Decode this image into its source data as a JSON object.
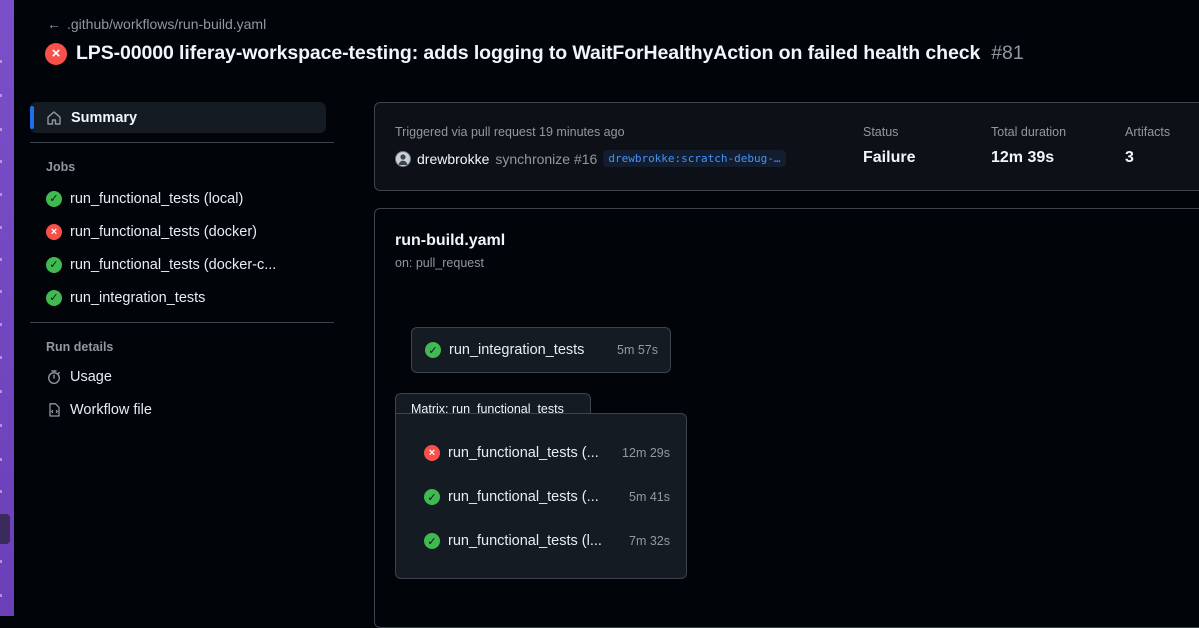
{
  "header": {
    "back_label": ".github/workflows/run-build.yaml",
    "title": "LPS-00000 liferay-workspace-testing: adds logging to WaitForHealthyAction on failed health check",
    "run_number": "#81",
    "status_icon": "x-circle-icon"
  },
  "sidebar": {
    "summary_label": "Summary",
    "jobs_heading": "Jobs",
    "jobs": [
      {
        "label": "run_functional_tests (local)",
        "status": "success"
      },
      {
        "label": "run_functional_tests (docker)",
        "status": "failure"
      },
      {
        "label": "run_functional_tests (docker-c...",
        "status": "success"
      },
      {
        "label": "run_integration_tests",
        "status": "success"
      }
    ],
    "run_details_heading": "Run details",
    "usage_label": "Usage",
    "workflow_file_label": "Workflow file"
  },
  "summary": {
    "triggered": "Triggered via pull request 19 minutes ago",
    "actor": "drewbrokke",
    "event": "synchronize #16",
    "branch": "drewbrokke:scratch-debug-…",
    "status_label": "Status",
    "status_value": "Failure",
    "duration_label": "Total duration",
    "duration_value": "12m 39s",
    "artifacts_label": "Artifacts",
    "artifacts_value": "3"
  },
  "graph": {
    "workflow_name": "run-build.yaml",
    "trigger": "on: pull_request",
    "integration_job": {
      "label": "run_integration_tests",
      "duration": "5m 57s",
      "status": "success"
    },
    "matrix_label": "Matrix: run_functional_tests",
    "matrix_jobs": [
      {
        "label": "run_functional_tests (...",
        "duration": "12m 29s",
        "status": "failure"
      },
      {
        "label": "run_functional_tests (...",
        "duration": "5m 41s",
        "status": "success"
      },
      {
        "label": "run_functional_tests (l...",
        "duration": "7m 32s",
        "status": "success"
      }
    ]
  },
  "colors": {
    "success": "#3fb950",
    "failure": "#f85149",
    "accent": "#1f6feb",
    "sidebar_strip": "#6f42c1"
  }
}
